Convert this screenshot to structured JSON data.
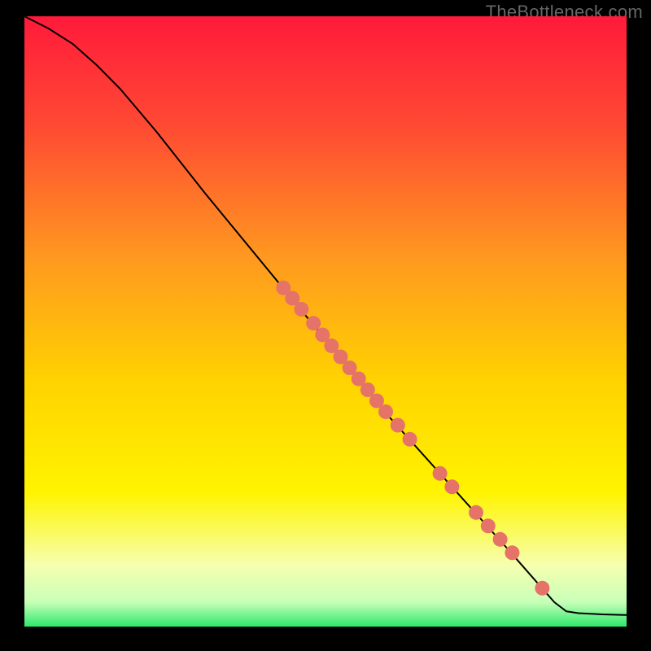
{
  "watermark": "TheBottleneck.com",
  "colors": {
    "gradient": [
      {
        "offset": "0%",
        "color": "#ff1a3a"
      },
      {
        "offset": "18%",
        "color": "#ff4a33"
      },
      {
        "offset": "40%",
        "color": "#ff9a1f"
      },
      {
        "offset": "60%",
        "color": "#ffd300"
      },
      {
        "offset": "78%",
        "color": "#fff400"
      },
      {
        "offset": "90%",
        "color": "#f6ffb0"
      },
      {
        "offset": "96%",
        "color": "#c8ffb8"
      },
      {
        "offset": "100%",
        "color": "#2ee86b"
      }
    ],
    "curve": "#000000",
    "point_fill": "#e57368",
    "point_stroke": "#b94a43"
  },
  "chart_data": {
    "type": "line",
    "title": "",
    "xlabel": "",
    "ylabel": "",
    "xlim": [
      0,
      100
    ],
    "ylim": [
      0,
      100
    ],
    "curve": [
      {
        "x": 0,
        "y": 100
      },
      {
        "x": 4,
        "y": 98
      },
      {
        "x": 8,
        "y": 95.5
      },
      {
        "x": 12,
        "y": 92
      },
      {
        "x": 16,
        "y": 88
      },
      {
        "x": 22,
        "y": 81
      },
      {
        "x": 30,
        "y": 71
      },
      {
        "x": 40,
        "y": 59
      },
      {
        "x": 50,
        "y": 47
      },
      {
        "x": 60,
        "y": 35
      },
      {
        "x": 70,
        "y": 24
      },
      {
        "x": 80,
        "y": 13
      },
      {
        "x": 88,
        "y": 4
      },
      {
        "x": 90,
        "y": 2.5
      },
      {
        "x": 92,
        "y": 2.2
      },
      {
        "x": 96,
        "y": 2.0
      },
      {
        "x": 100,
        "y": 1.9
      }
    ],
    "points": [
      {
        "x": 43,
        "y": 55.5
      },
      {
        "x": 44.5,
        "y": 53.8
      },
      {
        "x": 46,
        "y": 52
      },
      {
        "x": 48,
        "y": 49.7
      },
      {
        "x": 49.5,
        "y": 47.8
      },
      {
        "x": 51,
        "y": 46
      },
      {
        "x": 52.5,
        "y": 44.2
      },
      {
        "x": 54,
        "y": 42.4
      },
      {
        "x": 55.5,
        "y": 40.6
      },
      {
        "x": 57,
        "y": 38.8
      },
      {
        "x": 58.5,
        "y": 37
      },
      {
        "x": 60,
        "y": 35.2
      },
      {
        "x": 62,
        "y": 33
      },
      {
        "x": 64,
        "y": 30.7
      },
      {
        "x": 69,
        "y": 25.1
      },
      {
        "x": 71,
        "y": 22.9
      },
      {
        "x": 75,
        "y": 18.7
      },
      {
        "x": 77,
        "y": 16.5
      },
      {
        "x": 79,
        "y": 14.3
      },
      {
        "x": 81,
        "y": 12.1
      },
      {
        "x": 86,
        "y": 6.3
      }
    ],
    "point_radius": 9
  }
}
